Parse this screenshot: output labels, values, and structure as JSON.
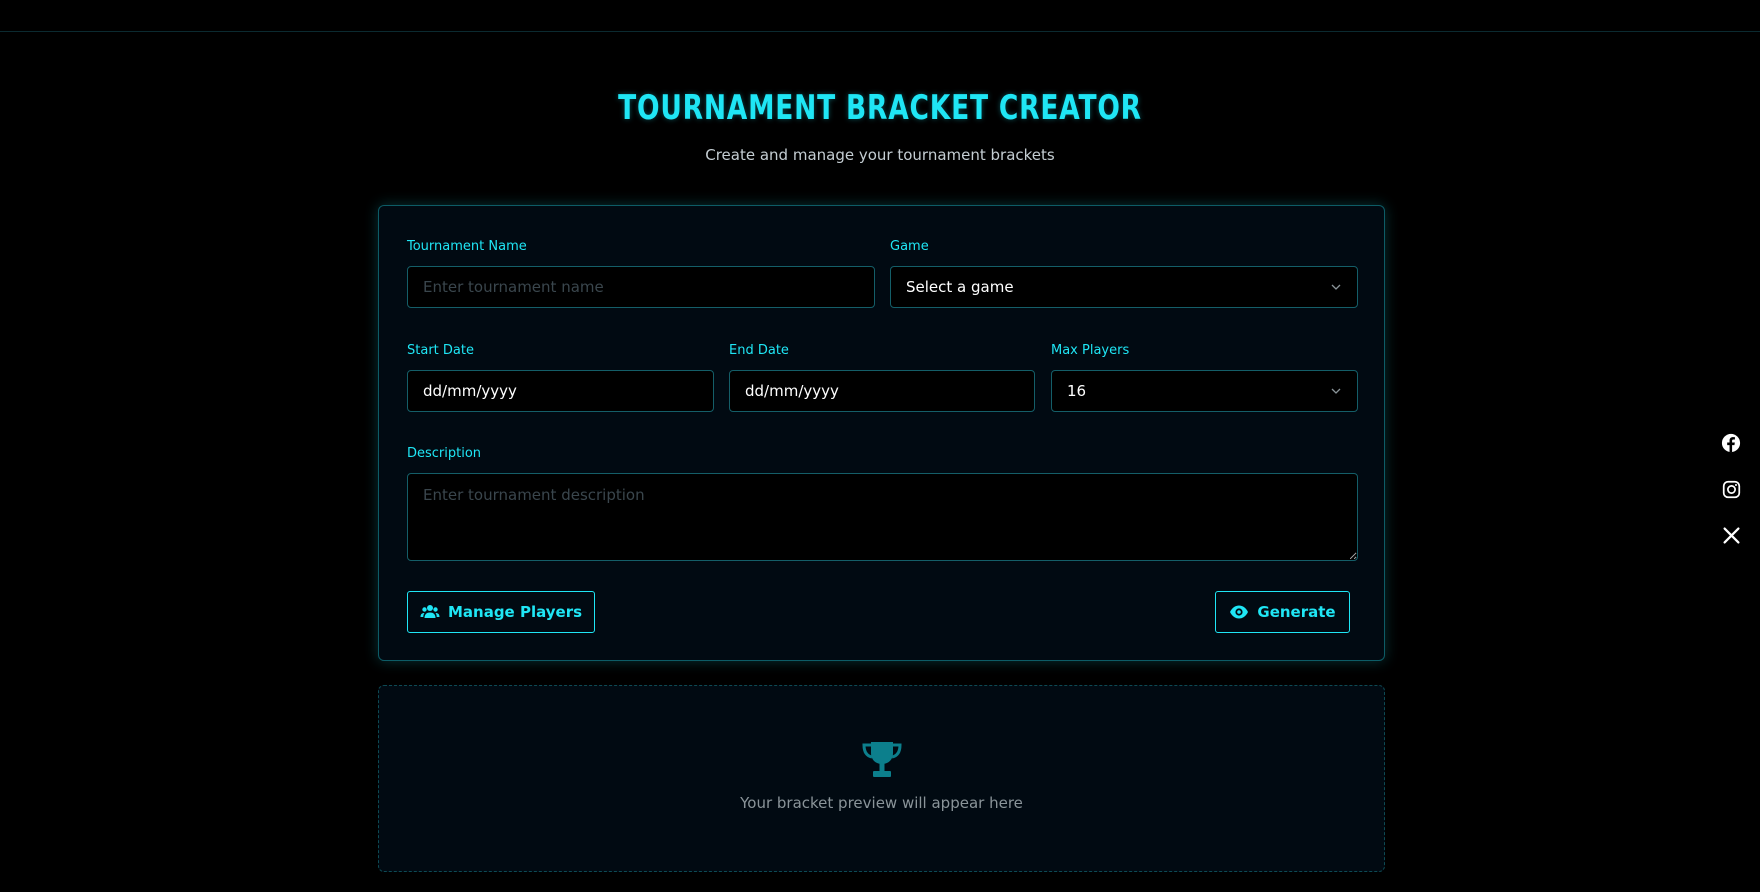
{
  "header": {
    "title": "TOURNAMENT BRACKET CREATOR",
    "subtitle": "Create and manage your tournament brackets"
  },
  "form": {
    "tournament_name_label": "Tournament Name",
    "tournament_name_placeholder": "Enter tournament name",
    "game_label": "Game",
    "game_value": "Select a game",
    "start_date_label": "Start Date",
    "start_date_value": "dd/mm/yyyy",
    "end_date_label": "End Date",
    "end_date_value": "dd/mm/yyyy",
    "max_players_label": "Max Players",
    "max_players_value": "16",
    "description_label": "Description",
    "description_placeholder": "Enter tournament description",
    "manage_players_label": "Manage Players",
    "generate_label": "Generate"
  },
  "preview": {
    "message": "Your bracket preview will appear here"
  },
  "social": [
    "facebook-icon",
    "instagram-icon",
    "x-icon"
  ],
  "colors": {
    "accent": "#1fe6f5",
    "background": "#000000",
    "card": "#010a12",
    "trophy": "#0c7f8c"
  }
}
